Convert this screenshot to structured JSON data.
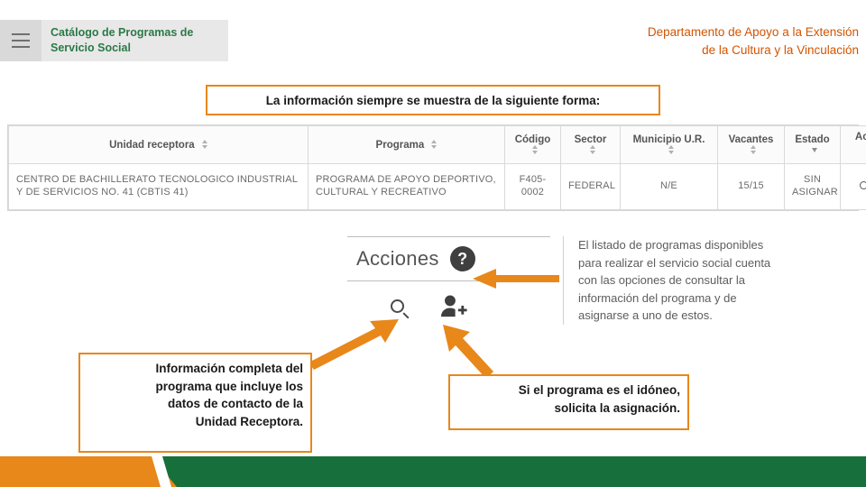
{
  "header": {
    "menu_icon": "hamburger-icon",
    "title_line1": "Catálogo de Programas de",
    "title_line2": "Servicio Social"
  },
  "department": {
    "line1": "Departamento de Apoyo a la Extensión",
    "line2": "de la Cultura y la Vinculación"
  },
  "callouts": {
    "top": "La información siempre se muestra de la siguiente forma:",
    "left_line1": "Información completa del",
    "left_line2": "programa que incluye los",
    "left_line3": "datos de contacto de la",
    "left_line4": "Unidad Receptora.",
    "right_line1": "Si el programa es el idóneo,",
    "right_line2": "solicita la asignación."
  },
  "table": {
    "headers": [
      "Unidad receptora",
      "Programa",
      "Código",
      "Sector",
      "Municipio U.R.",
      "Vacantes",
      "Estado",
      "Acciones"
    ],
    "help_badge": "?",
    "row": {
      "unidad_receptora": "CENTRO DE BACHILLERATO TECNOLOGICO INDUSTRIAL Y DE SERVICIOS NO. 41 (CBTIS 41)",
      "programa": "PROGRAMA DE APOYO DEPORTIVO, CULTURAL Y RECREATIVO",
      "codigo": "F405-0002",
      "sector": "FEDERAL",
      "municipio": "N/E",
      "vacantes": "15/15",
      "estado": "SIN ASIGNAR",
      "acciones_icons": [
        "search-icon",
        "person-add-icon"
      ]
    }
  },
  "zoom_block": {
    "label": "Acciones",
    "help_badge": "?",
    "icons": [
      "search-icon",
      "person-add-icon"
    ]
  },
  "description": {
    "line1": "El listado de programas disponibles",
    "line2": "para realizar el servicio social cuenta",
    "line3": "con las opciones de consultar la",
    "line4": "información del programa y de",
    "line5": "asignarse a uno de estos."
  },
  "colors": {
    "accent_orange": "#e8871a",
    "brand_green": "#17703b",
    "header_green_text": "#2b7a46",
    "dept_orange": "#d35400"
  }
}
